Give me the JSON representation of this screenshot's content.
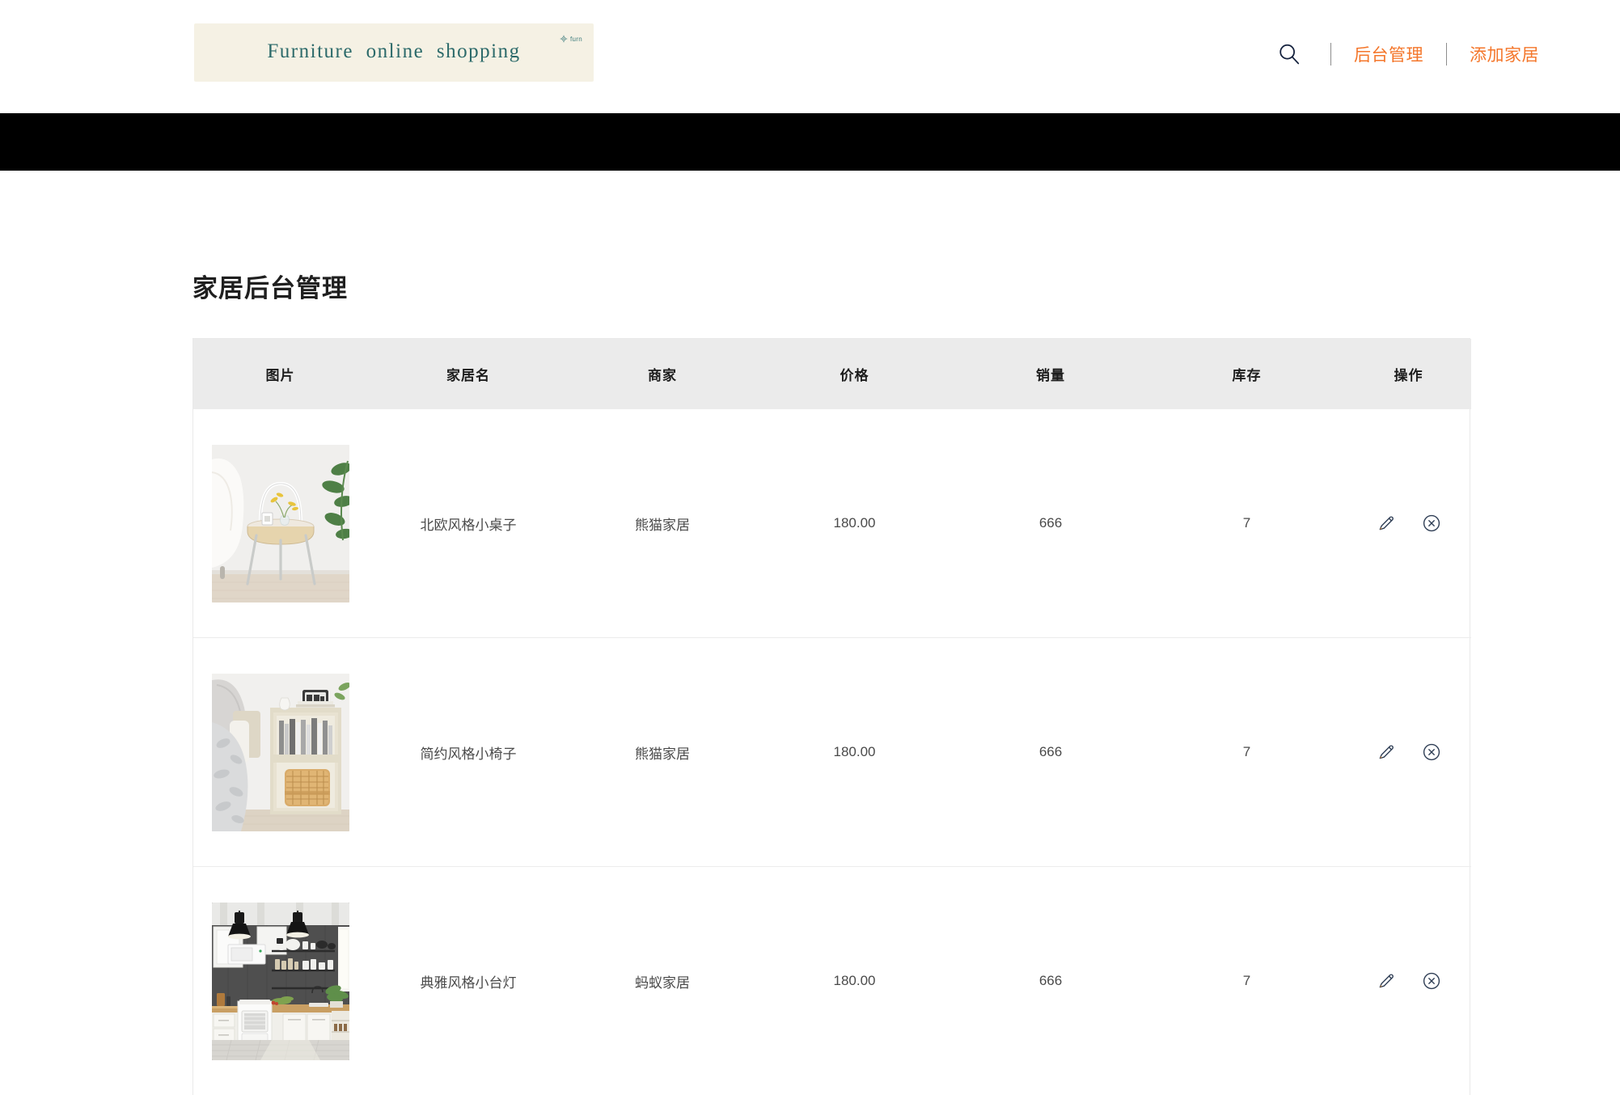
{
  "header": {
    "banner": {
      "title": "Furniture  online  shopping",
      "logo_text": "furn",
      "logo_icon": "furn-logo-icon"
    },
    "nav": {
      "search_icon": "search-icon",
      "links": [
        {
          "label": "后台管理"
        },
        {
          "label": "添加家居"
        }
      ]
    },
    "accent_color": "#f4762a",
    "banner_text_color": "#2c6a6a"
  },
  "main": {
    "page_title": "家居后台管理",
    "table": {
      "columns": [
        "图片",
        "家居名",
        "商家",
        "价格",
        "销量",
        "库存",
        "操作"
      ],
      "rows": [
        {
          "image": "nordic-side-table-photo",
          "name": "北欧风格小桌子",
          "shop": "熊猫家居",
          "price": "180.00",
          "sales": "666",
          "stock": "7",
          "actions": {
            "edit_icon": "pencil-edit-icon",
            "delete_icon": "circle-x-delete-icon"
          }
        },
        {
          "image": "minimal-nightstand-photo",
          "name": "简约风格小椅子",
          "shop": "熊猫家居",
          "price": "180.00",
          "sales": "666",
          "stock": "7",
          "actions": {
            "edit_icon": "pencil-edit-icon",
            "delete_icon": "circle-x-delete-icon"
          }
        },
        {
          "image": "elegant-kitchen-lamp-photo",
          "name": "典雅风格小台灯",
          "shop": "蚂蚁家居",
          "price": "180.00",
          "sales": "666",
          "stock": "7",
          "actions": {
            "edit_icon": "pencil-edit-icon",
            "delete_icon": "circle-x-delete-icon"
          }
        }
      ]
    }
  },
  "colors": {
    "nav_bar": "#000000",
    "table_header_bg": "#ebebeb",
    "row_divider": "#ececec",
    "icon_stroke": "#2f3e55"
  }
}
